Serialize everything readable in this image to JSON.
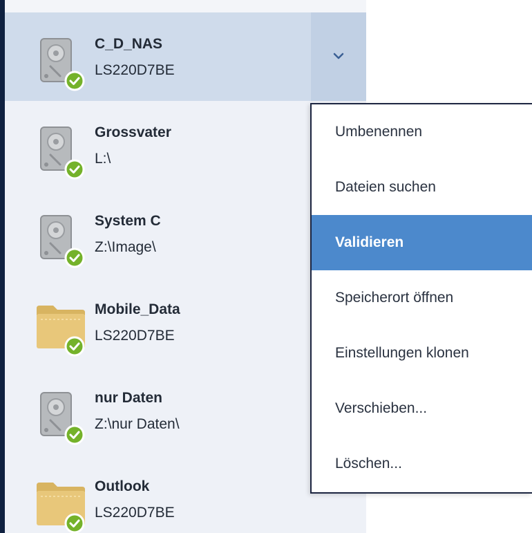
{
  "colors": {
    "sidebar_bg": "#eef1f7",
    "selected_bg": "#cfdbeb",
    "chevron_bg": "#c1d0e4",
    "accent_blue": "#4c89cc",
    "status_green": "#74b22a",
    "folder_yellow": "#e8c77a",
    "left_strip": "#0f2140"
  },
  "backups": [
    {
      "title": "C_D_NAS",
      "subtitle": "LS220D7BE",
      "icon": "hard-drive-icon",
      "status": "ok-check-icon",
      "selected": true
    },
    {
      "title": "Grossvater",
      "subtitle": "L:\\",
      "icon": "hard-drive-icon",
      "status": "ok-check-icon",
      "selected": false
    },
    {
      "title": "System C",
      "subtitle": "Z:\\Image\\",
      "icon": "hard-drive-icon",
      "status": "ok-check-icon",
      "selected": false
    },
    {
      "title": "Mobile_Data",
      "subtitle": "LS220D7BE",
      "icon": "folder-icon",
      "status": "ok-check-icon",
      "selected": false
    },
    {
      "title": "nur Daten",
      "subtitle": "Z:\\nur Daten\\",
      "icon": "hard-drive-icon",
      "status": "ok-check-icon",
      "selected": false
    },
    {
      "title": "Outlook",
      "subtitle": "LS220D7BE",
      "icon": "folder-icon",
      "status": "ok-check-icon",
      "selected": false
    }
  ],
  "context_menu": {
    "items": [
      {
        "label": "Umbenennen",
        "active": false
      },
      {
        "label": "Dateien suchen",
        "active": false
      },
      {
        "label": "Validieren",
        "active": true
      },
      {
        "label": "Speicherort öffnen",
        "active": false
      },
      {
        "label": "Einstellungen klonen",
        "active": false
      },
      {
        "label": "Verschieben...",
        "active": false
      },
      {
        "label": "Löschen...",
        "active": false
      }
    ]
  },
  "chevron_icon": "chevron-down-icon"
}
